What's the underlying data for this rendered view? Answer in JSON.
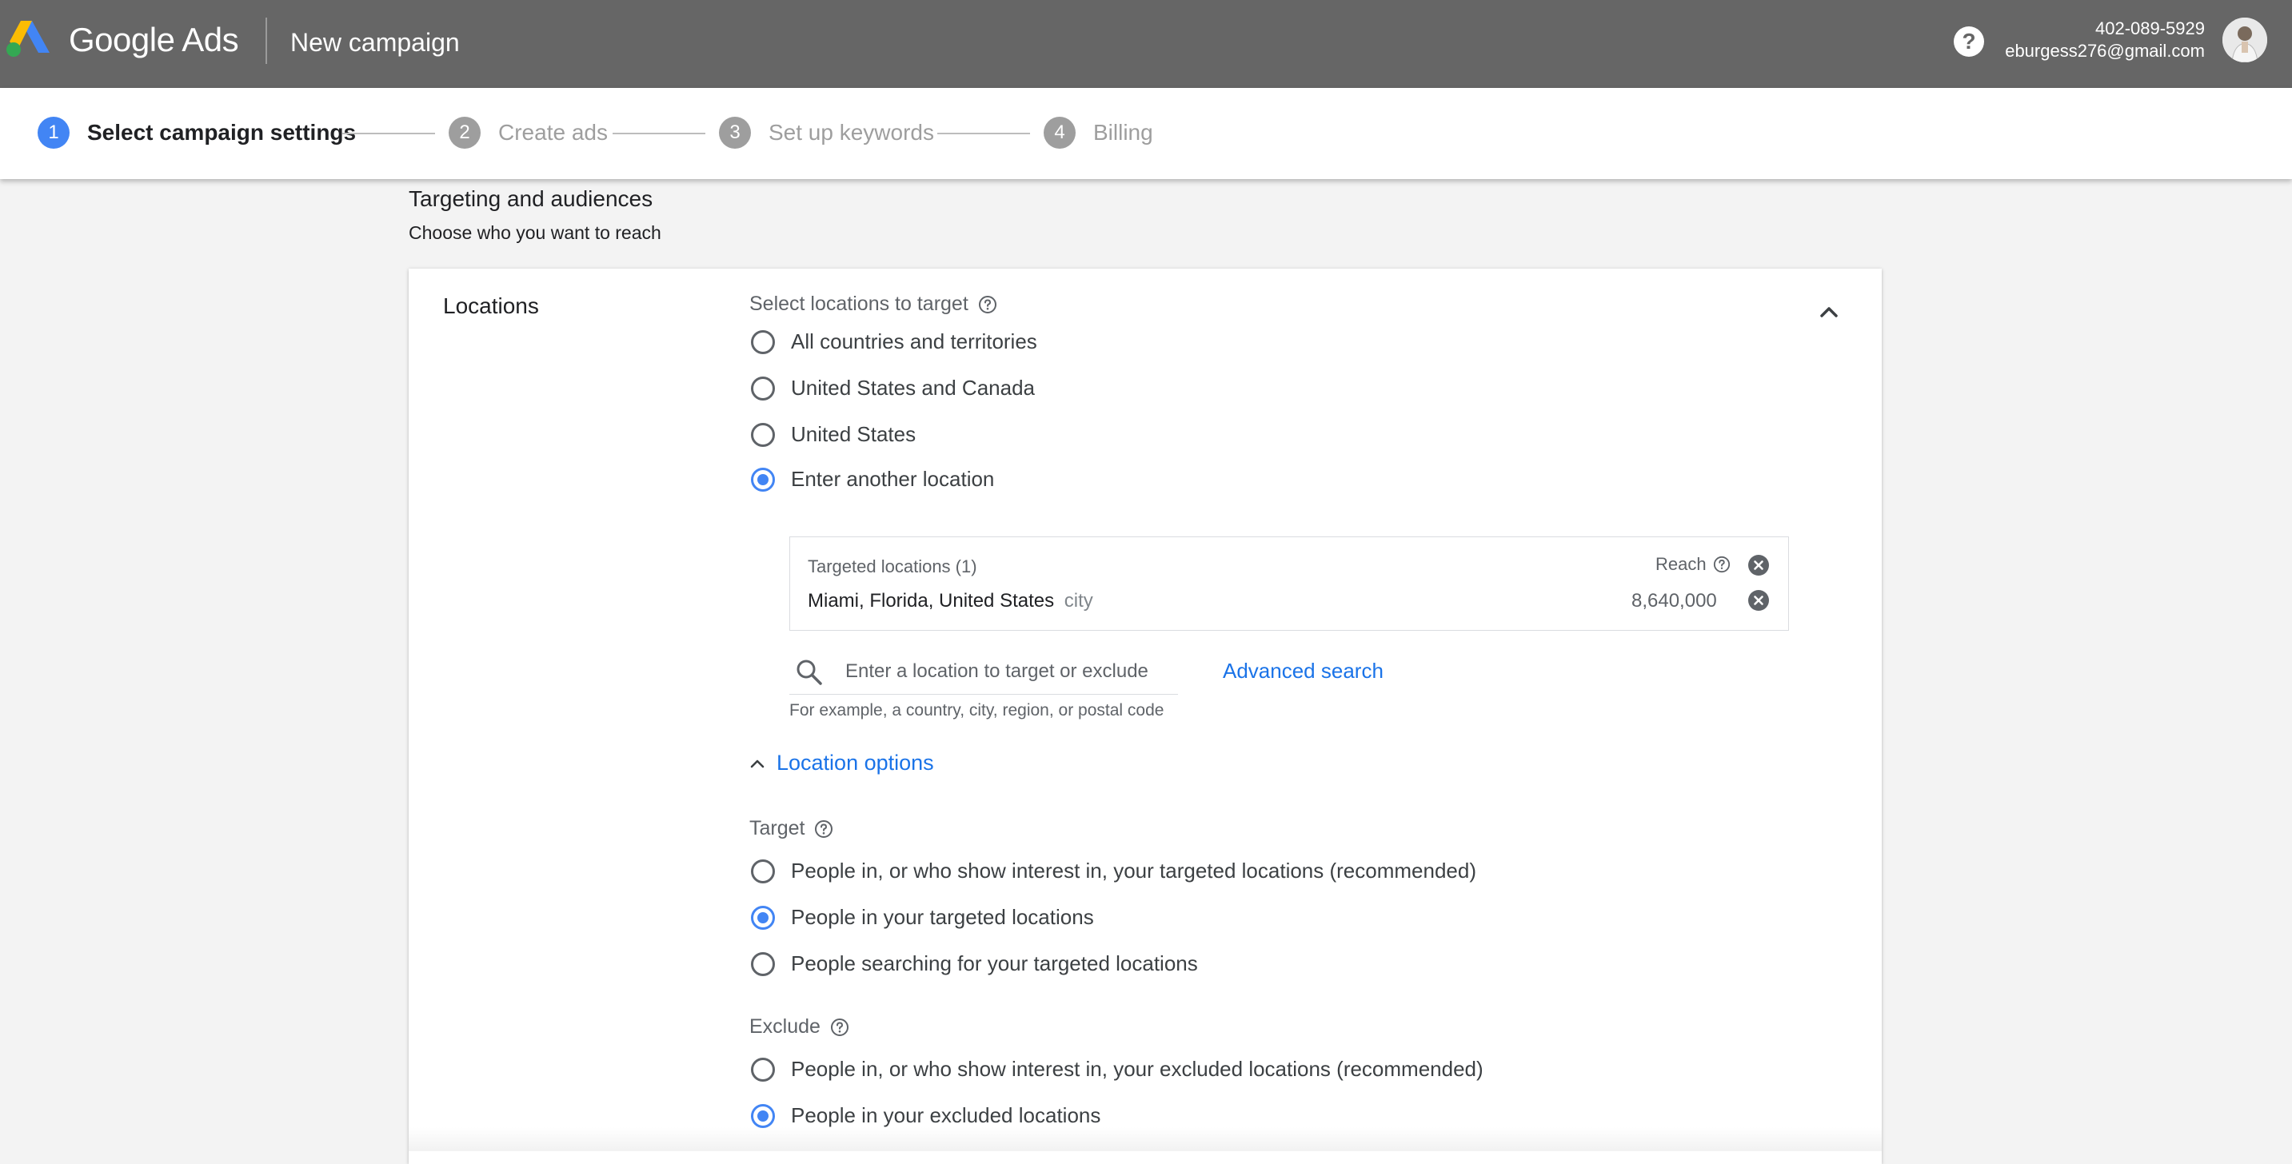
{
  "header": {
    "brand": "Google Ads",
    "page_title": "New campaign",
    "help_label": "?",
    "phone": "402-089-5929",
    "email": "eburgess276@gmail.com"
  },
  "stepper": {
    "steps": [
      {
        "number": "1",
        "label": "Select campaign settings",
        "active": true
      },
      {
        "number": "2",
        "label": "Create ads",
        "active": false
      },
      {
        "number": "3",
        "label": "Set up keywords",
        "active": false
      },
      {
        "number": "4",
        "label": "Billing",
        "active": false
      }
    ]
  },
  "section": {
    "title": "Targeting and audiences",
    "subtitle": "Choose who you want to reach"
  },
  "locations": {
    "card_label": "Locations",
    "select_label": "Select locations to target",
    "options": [
      {
        "label": "All countries and territories",
        "checked": false
      },
      {
        "label": "United States and Canada",
        "checked": false
      },
      {
        "label": "United States",
        "checked": false
      },
      {
        "label": "Enter another location",
        "checked": true
      }
    ],
    "targeted": {
      "header": "Targeted locations (1)",
      "reach_label": "Reach",
      "items": [
        {
          "name": "Miami, Florida, United States",
          "type": "city",
          "reach": "8,640,000"
        }
      ]
    },
    "search": {
      "placeholder": "Enter a location to target or exclude",
      "value": "",
      "advanced_label": "Advanced search",
      "hint": "For example, a country, city, region, or postal code"
    },
    "location_options_label": "Location options",
    "target": {
      "label": "Target",
      "options": [
        {
          "label": "People in, or who show interest in, your targeted locations (recommended)",
          "checked": false
        },
        {
          "label": "People in your targeted locations",
          "checked": true
        },
        {
          "label": "People searching for your targeted locations",
          "checked": false
        }
      ]
    },
    "exclude": {
      "label": "Exclude",
      "options": [
        {
          "label": "People in, or who show interest in, your excluded locations (recommended)",
          "checked": false
        },
        {
          "label": "People in your excluded locations",
          "checked": true
        }
      ]
    }
  },
  "colors": {
    "accent": "#4285f4",
    "link": "#1a73e8",
    "header_bg": "#666666"
  }
}
